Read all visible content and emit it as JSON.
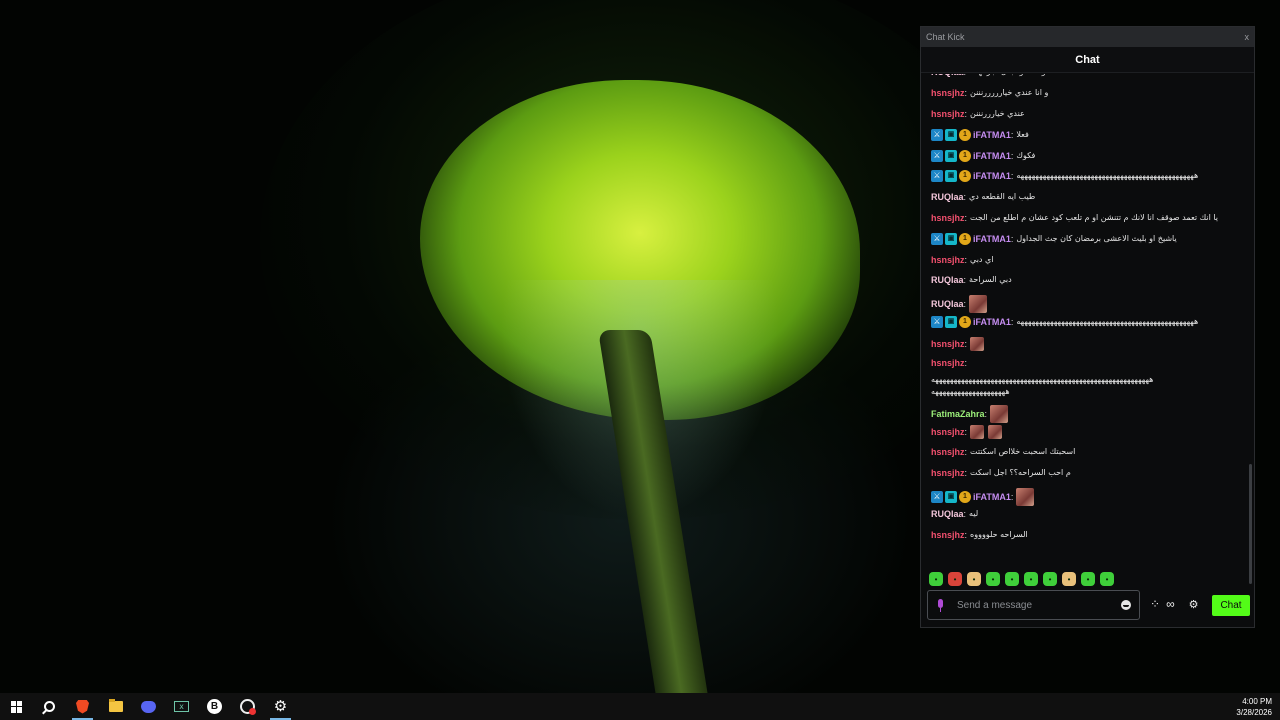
{
  "window": {
    "title": "Chat Kick",
    "close_glyph": "x"
  },
  "chat": {
    "header": "Chat"
  },
  "colors": {
    "ruqiaa": "#f2c5d9",
    "hsnsjhz": "#f2506e",
    "ifatma1": "#c58df0",
    "fatimazahra": "#9cf07a",
    "kick_green": "#53fc18"
  },
  "messages": [
    {
      "user": "RUQIaa",
      "color_key": "ruqiaa",
      "text": "والله كود بكل اجزائها لا",
      "badges": []
    },
    {
      "user": "hsnsjhz",
      "color_key": "hsnsjhz",
      "text": "و انا عندي خيارررررنننن",
      "badges": []
    },
    {
      "user": "hsnsjhz",
      "color_key": "hsnsjhz",
      "text": "عندي خيارررنننن",
      "badges": []
    },
    {
      "user": "iFATMA1",
      "color_key": "ifatma1",
      "text": "فعلا",
      "badges": [
        "sword",
        "vip",
        "sub"
      ]
    },
    {
      "user": "iFATMA1",
      "color_key": "ifatma1",
      "text": "فكوك",
      "badges": [
        "sword",
        "vip",
        "sub"
      ]
    },
    {
      "user": "iFATMA1",
      "color_key": "ifatma1",
      "text": "ههههههههههههههههههههههههههههههههههههههههههههههههه",
      "badges": [
        "sword",
        "vip",
        "sub"
      ]
    },
    {
      "user": "RUQIaa",
      "color_key": "ruqiaa",
      "text": "طيب ايه القطعه دي",
      "badges": []
    },
    {
      "user": "hsnsjhz",
      "color_key": "hsnsjhz",
      "text": "يا انك تعمد صوقف انا لانك م تتنشن او م تلعب كود عشان م اطلع من الجت",
      "badges": []
    },
    {
      "user": "iFATMA1",
      "color_key": "ifatma1",
      "text": "ياشيخ او بليث الاعشى برمضان كان جث الجداول",
      "badges": [
        "sword",
        "vip",
        "sub"
      ]
    },
    {
      "user": "hsnsjhz",
      "color_key": "hsnsjhz",
      "text": "اي دبي",
      "badges": []
    },
    {
      "user": "RUQIaa",
      "color_key": "ruqiaa",
      "text": "دبي السراحة",
      "badges": []
    },
    {
      "user": "RUQIaa",
      "color_key": "ruqiaa",
      "text": "",
      "badges": [],
      "emotes": 1
    },
    {
      "user": "iFATMA1",
      "color_key": "ifatma1",
      "text": "ههههههههههههههههههههههههههههههههههههههههههههههههه",
      "badges": [
        "sword",
        "vip",
        "sub"
      ]
    },
    {
      "user": "hsnsjhz",
      "color_key": "hsnsjhz",
      "text": "",
      "badges": [],
      "emotes": 1
    },
    {
      "user": "hsnsjhz",
      "color_key": "hsnsjhz",
      "text": "",
      "badges": []
    },
    {
      "user": "",
      "color_key": "hsnsjhz",
      "text": "هههههههههههههههههههههههههههههههههههههههههههههههههههههههههههه",
      "badges": []
    },
    {
      "user": "",
      "color_key": "hsnsjhz",
      "text": "ههههههههههههههههههههه",
      "badges": []
    },
    {
      "user": "FatimaZahra",
      "color_key": "fatimazahra",
      "text": "",
      "badges": [],
      "emotes": 1
    },
    {
      "user": "hsnsjhz",
      "color_key": "hsnsjhz",
      "text": "",
      "badges": [],
      "emotes": 2
    },
    {
      "user": "hsnsjhz",
      "color_key": "hsnsjhz",
      "text": "اسحبتك اسحبت خلااص اسكتتت",
      "badges": []
    },
    {
      "user": "hsnsjhz",
      "color_key": "hsnsjhz",
      "text": "م احب السراحه؟؟ اجل اسكت",
      "badges": []
    },
    {
      "user": "iFATMA1",
      "color_key": "ifatma1",
      "text": "",
      "badges": [
        "sword",
        "vip",
        "sub"
      ],
      "emotes": 1
    },
    {
      "user": "RUQIaa",
      "color_key": "ruqiaa",
      "text": "ليه",
      "badges": []
    },
    {
      "user": "hsnsjhz",
      "color_key": "hsnsjhz",
      "text": "السراحه حلووووه",
      "badges": []
    }
  ],
  "input": {
    "placeholder": "Send a message",
    "value": ""
  },
  "buttons": {
    "chat_label": "Chat",
    "kicks_label": "∞"
  },
  "taskbar": {
    "items": [
      "start-icon",
      "search-icon",
      "brave-icon",
      "file-explorer-icon",
      "discord-icon",
      "terminal-icon",
      "b-app-icon",
      "recorder-icon",
      "settings-icon"
    ],
    "time": "4:00 PM",
    "date": "3/28/2026"
  }
}
